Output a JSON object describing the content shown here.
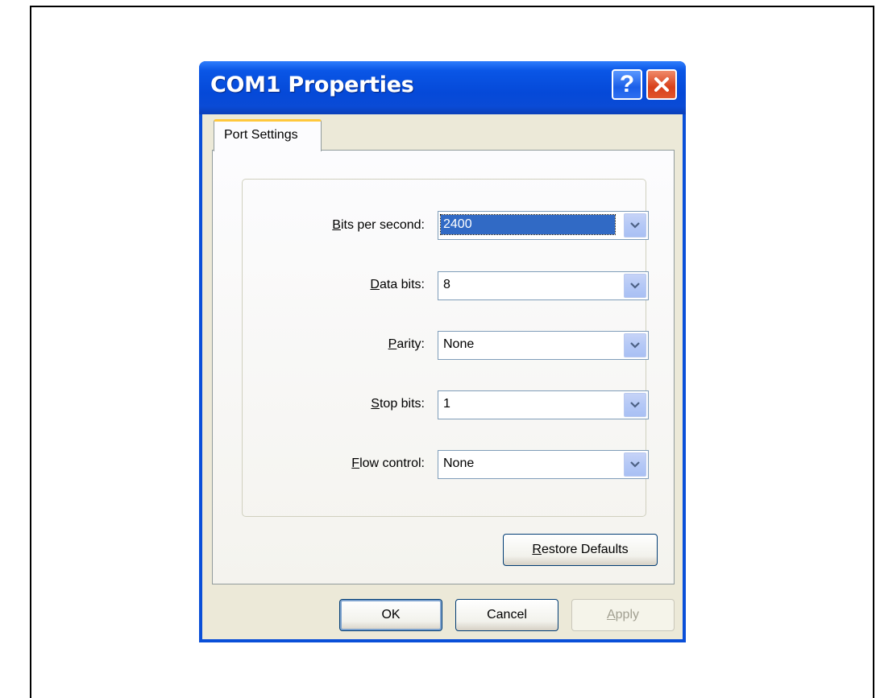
{
  "window": {
    "title": "COM1 Properties",
    "help_label": "?",
    "close_icon": "close-icon"
  },
  "tabs": [
    {
      "label": "Port Settings",
      "active": true
    }
  ],
  "fields": [
    {
      "mnemonic": "B",
      "rest": "its per second:",
      "value": "2400",
      "focused": true
    },
    {
      "mnemonic": "D",
      "rest": "ata bits:",
      "value": "8"
    },
    {
      "mnemonic": "P",
      "rest": "arity:",
      "value": "None"
    },
    {
      "mnemonic": "S",
      "rest": "top bits:",
      "value": "1"
    },
    {
      "mnemonic": "F",
      "rest": "low control:",
      "value": "None"
    }
  ],
  "restore_button": {
    "mnemonic": "R",
    "rest": "estore Defaults"
  },
  "buttons": {
    "ok": "OK",
    "cancel": "Cancel",
    "apply_mnemonic": "A",
    "apply_rest": "pply"
  },
  "colors": {
    "titlebar": "#0549d8",
    "selection": "#316ac5",
    "tab_accent": "#ffc83c",
    "dialog_bg": "#ece9d8"
  }
}
